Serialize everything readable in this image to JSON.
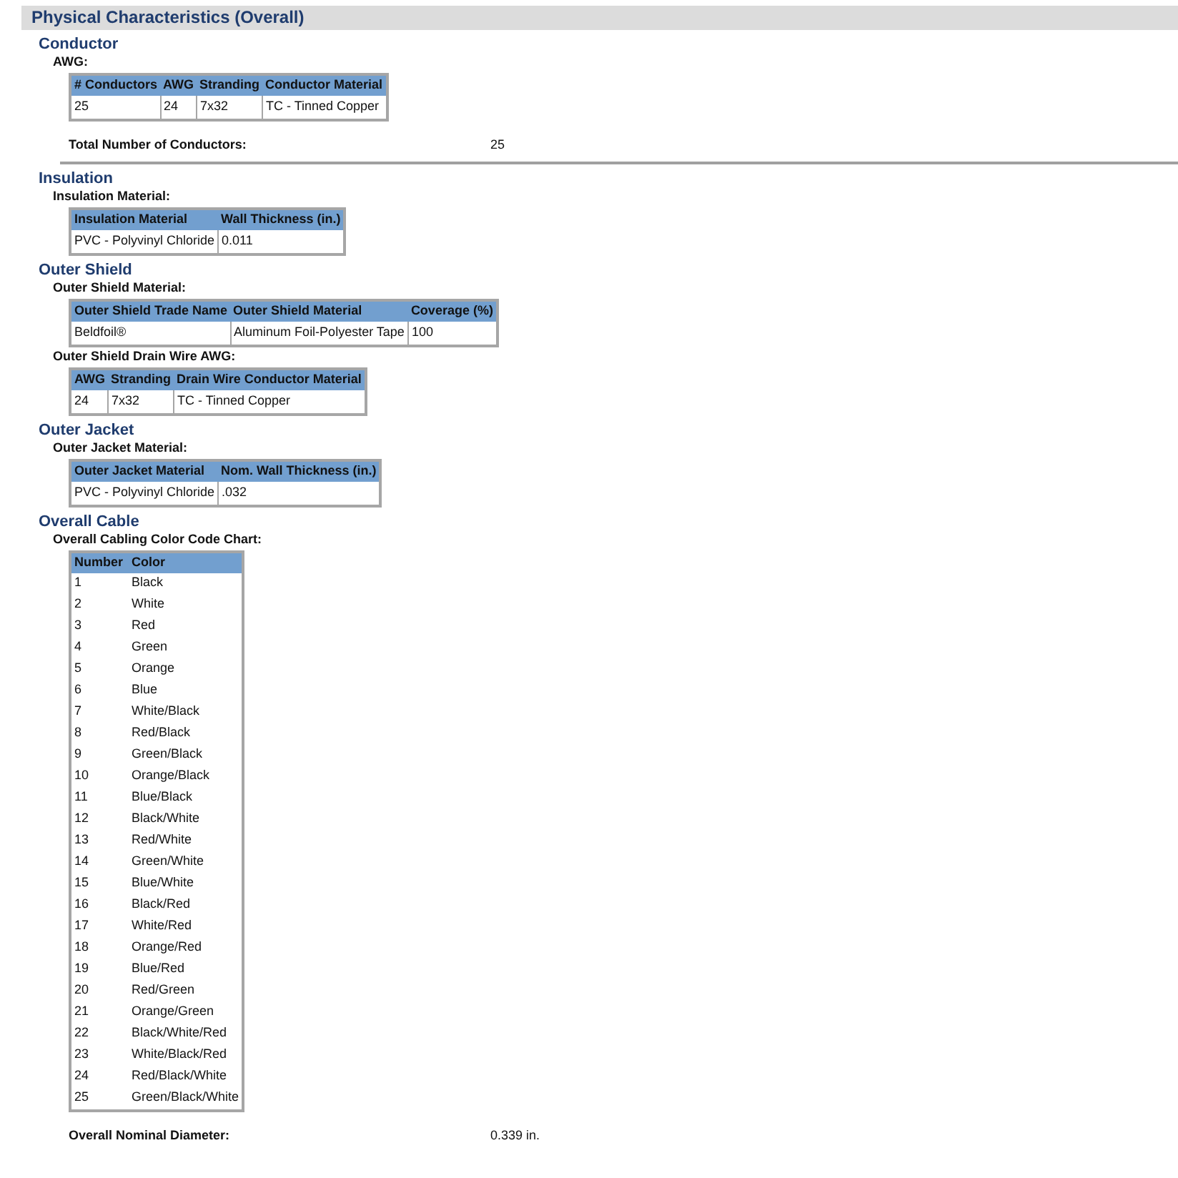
{
  "title": "Physical Characteristics (Overall)",
  "sections": [
    {
      "heading": "Conductor",
      "blocks": [
        {
          "kind": "table",
          "label": "AWG:",
          "columns": [
            "# Conductors",
            "AWG",
            "Stranding",
            "Conductor Material"
          ],
          "rows": [
            [
              "25",
              "24",
              "7x32",
              "TC - Tinned Copper"
            ]
          ]
        },
        {
          "kind": "value",
          "label": "Total Number of Conductors:",
          "value": "25",
          "rule_below": true
        }
      ]
    },
    {
      "heading": "Insulation",
      "blocks": [
        {
          "kind": "table",
          "label": "Insulation Material:",
          "columns": [
            "Insulation Material",
            "Wall Thickness (in.)"
          ],
          "rows": [
            [
              "PVC - Polyvinyl Chloride",
              "0.011"
            ]
          ]
        }
      ]
    },
    {
      "heading": "Outer Shield",
      "blocks": [
        {
          "kind": "table",
          "label": "Outer Shield Material:",
          "columns": [
            "Outer Shield Trade Name",
            "Outer Shield Material",
            "Coverage (%)"
          ],
          "rows": [
            [
              "Beldfoil®",
              "Aluminum Foil-Polyester Tape",
              "100"
            ]
          ]
        },
        {
          "kind": "table",
          "label": "Outer Shield Drain Wire AWG:",
          "columns": [
            "AWG",
            "Stranding",
            "Drain Wire Conductor Material"
          ],
          "rows": [
            [
              "24",
              "7x32",
              "TC - Tinned Copper"
            ]
          ]
        }
      ]
    },
    {
      "heading": "Outer Jacket",
      "blocks": [
        {
          "kind": "table",
          "label": "Outer Jacket Material:",
          "columns": [
            "Outer Jacket Material",
            "Nom. Wall Thickness (in.)"
          ],
          "rows": [
            [
              "PVC - Polyvinyl Chloride",
              ".032"
            ]
          ]
        }
      ]
    },
    {
      "heading": "Overall Cable",
      "blocks": [
        {
          "kind": "list",
          "label": "Overall Cabling Color Code Chart:",
          "columns": [
            "Number",
            "Color"
          ],
          "rows": [
            [
              "1",
              "Black"
            ],
            [
              "2",
              "White"
            ],
            [
              "3",
              "Red"
            ],
            [
              "4",
              "Green"
            ],
            [
              "5",
              "Orange"
            ],
            [
              "6",
              "Blue"
            ],
            [
              "7",
              "White/Black"
            ],
            [
              "8",
              "Red/Black"
            ],
            [
              "9",
              "Green/Black"
            ],
            [
              "10",
              "Orange/Black"
            ],
            [
              "11",
              "Blue/Black"
            ],
            [
              "12",
              "Black/White"
            ],
            [
              "13",
              "Red/White"
            ],
            [
              "14",
              "Green/White"
            ],
            [
              "15",
              "Blue/White"
            ],
            [
              "16",
              "Black/Red"
            ],
            [
              "17",
              "White/Red"
            ],
            [
              "18",
              "Orange/Red"
            ],
            [
              "19",
              "Blue/Red"
            ],
            [
              "20",
              "Red/Green"
            ],
            [
              "21",
              "Orange/Green"
            ],
            [
              "22",
              "Black/White/Red"
            ],
            [
              "23",
              "White/Black/Red"
            ],
            [
              "24",
              "Red/Black/White"
            ],
            [
              "25",
              "Green/Black/White"
            ]
          ]
        },
        {
          "kind": "value",
          "label": "Overall Nominal Diameter:",
          "value": "0.339 in.",
          "rule_below": false
        }
      ]
    }
  ]
}
